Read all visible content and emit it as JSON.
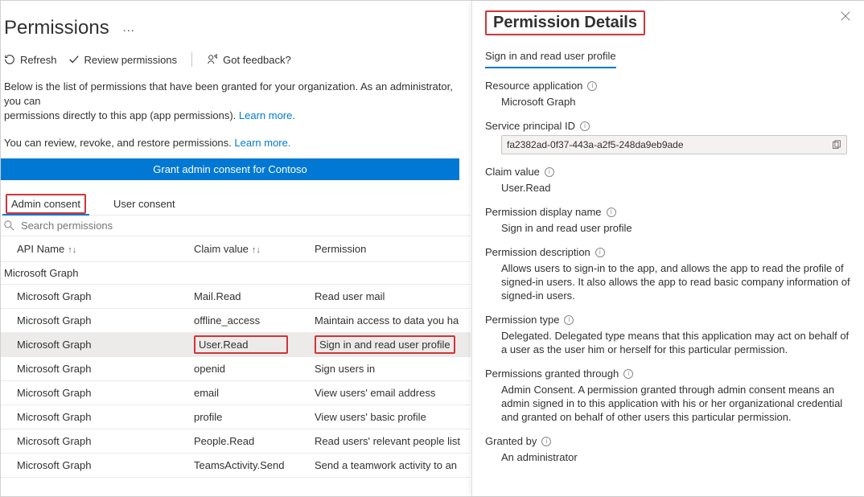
{
  "page": {
    "title": "Permissions"
  },
  "toolbar": {
    "refresh": "Refresh",
    "review": "Review permissions",
    "feedback": "Got feedback?"
  },
  "intro": {
    "line1a": "Below is the list of permissions that have been granted for your organization. As an administrator, you can ",
    "line1b": "permissions directly to this app (app permissions). ",
    "learn1": "Learn more.",
    "line2": "You can review, revoke, and restore permissions. ",
    "learn2": "Learn more."
  },
  "grant_button": "Grant admin consent for Contoso",
  "tabs": {
    "admin": "Admin consent",
    "user": "User consent"
  },
  "search": {
    "placeholder": "Search permissions"
  },
  "columns": {
    "api": "API Name",
    "claim": "Claim value",
    "perm": "Permission"
  },
  "group": "Microsoft Graph",
  "rows": [
    {
      "api": "Microsoft Graph",
      "claim": "Mail.Read",
      "perm": "Read user mail",
      "selected": false
    },
    {
      "api": "Microsoft Graph",
      "claim": "offline_access",
      "perm": "Maintain access to data you ha",
      "selected": false
    },
    {
      "api": "Microsoft Graph",
      "claim": "User.Read",
      "perm": "Sign in and read user profile",
      "selected": true
    },
    {
      "api": "Microsoft Graph",
      "claim": "openid",
      "perm": "Sign users in",
      "selected": false
    },
    {
      "api": "Microsoft Graph",
      "claim": "email",
      "perm": "View users' email address",
      "selected": false
    },
    {
      "api": "Microsoft Graph",
      "claim": "profile",
      "perm": "View users' basic profile",
      "selected": false
    },
    {
      "api": "Microsoft Graph",
      "claim": "People.Read",
      "perm": "Read users' relevant people list",
      "selected": false
    },
    {
      "api": "Microsoft Graph",
      "claim": "TeamsActivity.Send",
      "perm": "Send a teamwork activity to an",
      "selected": false
    }
  ],
  "panel": {
    "title": "Permission Details",
    "tab": "Sign in and read user profile",
    "resource_app_label": "Resource application",
    "resource_app_value": "Microsoft Graph",
    "spid_label": "Service principal ID",
    "spid_value": "fa2382ad-0f37-443a-a2f5-248da9eb9ade",
    "claim_label": "Claim value",
    "claim_value": "User.Read",
    "display_label": "Permission display name",
    "display_value": "Sign in and read user profile",
    "desc_label": "Permission description",
    "desc_value": "Allows users to sign-in to the app, and allows the app to read the profile of signed-in users. It also allows the app to read basic company information of signed-in users.",
    "type_label": "Permission type",
    "type_value": "Delegated. Delegated type means that this application may act on behalf of a user as the user him or herself for this particular permission.",
    "granted_through_label": "Permissions granted through",
    "granted_through_value": "Admin Consent. A permission granted through admin consent means an admin signed in to this application with his or her organizational credential and granted on behalf of other users this particular permission.",
    "granted_by_label": "Granted by",
    "granted_by_value": "An administrator"
  }
}
